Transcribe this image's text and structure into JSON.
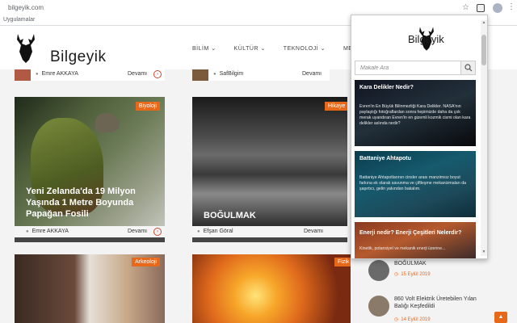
{
  "browser": {
    "url": "bilgeyik.com",
    "bookmarks_label": "Uygulamalar"
  },
  "site": {
    "logo_text": "Bilgeyik",
    "nav": [
      "BİLİM ⌄",
      "KÜLTÜR ⌄",
      "TEKNOLOJİ ⌄",
      "MEDYA ⌄"
    ]
  },
  "top_row": [
    {
      "author": "Emre AKKAYA",
      "more": "Devamı"
    },
    {
      "author": "SafBilgim",
      "more": "Devamı"
    }
  ],
  "cards": [
    {
      "category": "Biyoloji",
      "title": "Yeni Zelanda'da 19 Milyon Yaşında 1 Metre Boyunda Papağan Fosili",
      "author": "Emre AKKAYA",
      "more": "Devamı"
    },
    {
      "category": "Hikaye",
      "title": "BOĞULMAK",
      "author": "Efşan Göral",
      "more": "Devamı"
    },
    {
      "category": "Arkeoloji"
    },
    {
      "category": "Fizik"
    }
  ],
  "popup": {
    "logo_text": "Bilgeyik",
    "search_placeholder": "Makale Ara",
    "posts": [
      {
        "title": "Kara Delikler Nedir?",
        "excerpt": "Evren'in En Büyük Bilinmezliği Kara Delikler. NASA'nın paylaştığı fotoğraflardan sonra hepimizde daha da çok merak uyandıran Evren'in en gizemli kozmik cismi olan kara delikler aslında nedir?"
      },
      {
        "title": "Battaniye Ahtapotu",
        "excerpt": "Battaniye Ahtapotlarının cinsler arası manzimsız boyut farkına ek olarak savunma ve çiftleşme mekanizmaları da şaşırtıcı, gelin yakından bakalım."
      },
      {
        "title": "Enerji nedir? Enerji Çeşitleri Nelerdir?",
        "excerpt": "Kinetik, potansiyel ve mekanik enerji üzerine..."
      }
    ]
  },
  "sidebar": [
    {
      "title": "BOĞULMAK",
      "date": "15 Eylül 2019"
    },
    {
      "title": "860 Volt Elektrik Üretebilen Yılan Balığı Keşfedildi",
      "date": "14 Eylül 2019"
    }
  ],
  "back_to_top": "▲"
}
